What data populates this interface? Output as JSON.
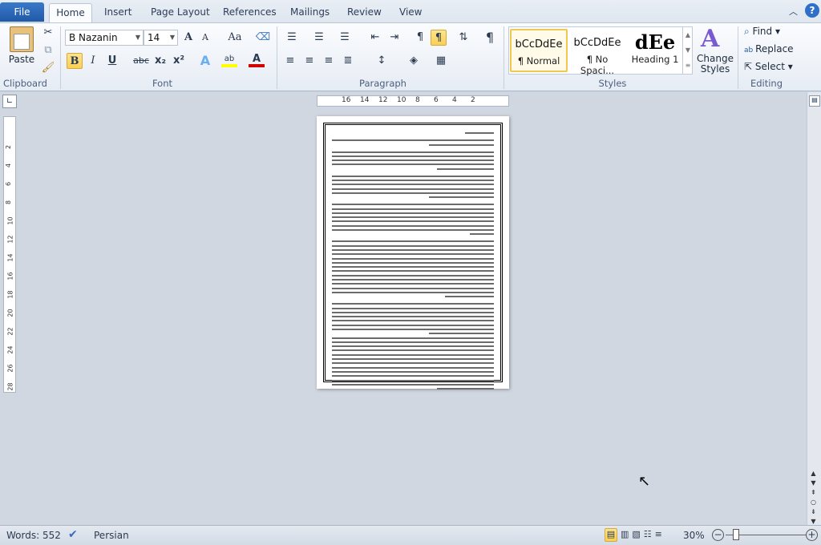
{
  "tabs": {
    "file": "File",
    "items": [
      "Home",
      "Insert",
      "Page Layout",
      "References",
      "Mailings",
      "Review",
      "View"
    ]
  },
  "clipboard": {
    "paste": "Paste",
    "group": "Clipboard"
  },
  "font": {
    "name": "B Nazanin",
    "size": "14",
    "group": "Font",
    "bold": "B",
    "italic": "I",
    "underline": "U",
    "strike": "abc",
    "sub": "x₂",
    "sup": "x²",
    "grow": "A",
    "shrink": "A",
    "case": "Aa"
  },
  "paragraph": {
    "group": "Paragraph"
  },
  "styles": {
    "group": "Styles",
    "items": [
      {
        "preview": "bCcDdEe",
        "label": "¶ Normal"
      },
      {
        "preview": "bCcDdEe",
        "label": "¶ No Spaci..."
      },
      {
        "preview": "dEe",
        "label": "Heading 1"
      }
    ],
    "change": "Change Styles"
  },
  "editing": {
    "group": "Editing",
    "find": "Find",
    "replace": "Replace",
    "select": "Select"
  },
  "ruler": {
    "h": [
      "16",
      "14",
      "12",
      "10",
      "8",
      "6",
      "4",
      "2"
    ],
    "v": [
      "2",
      "4",
      "6",
      "8",
      "10",
      "12",
      "14",
      "16",
      "18",
      "20",
      "22",
      "24",
      "26",
      "28"
    ]
  },
  "status": {
    "words": "Words: 552",
    "language": "Persian",
    "zoom": "30%"
  },
  "colors": {
    "file_tab": "#2a6ac0",
    "accent": "#f9cf55",
    "font_color": "#d00000",
    "highlight": "#ffff00"
  }
}
